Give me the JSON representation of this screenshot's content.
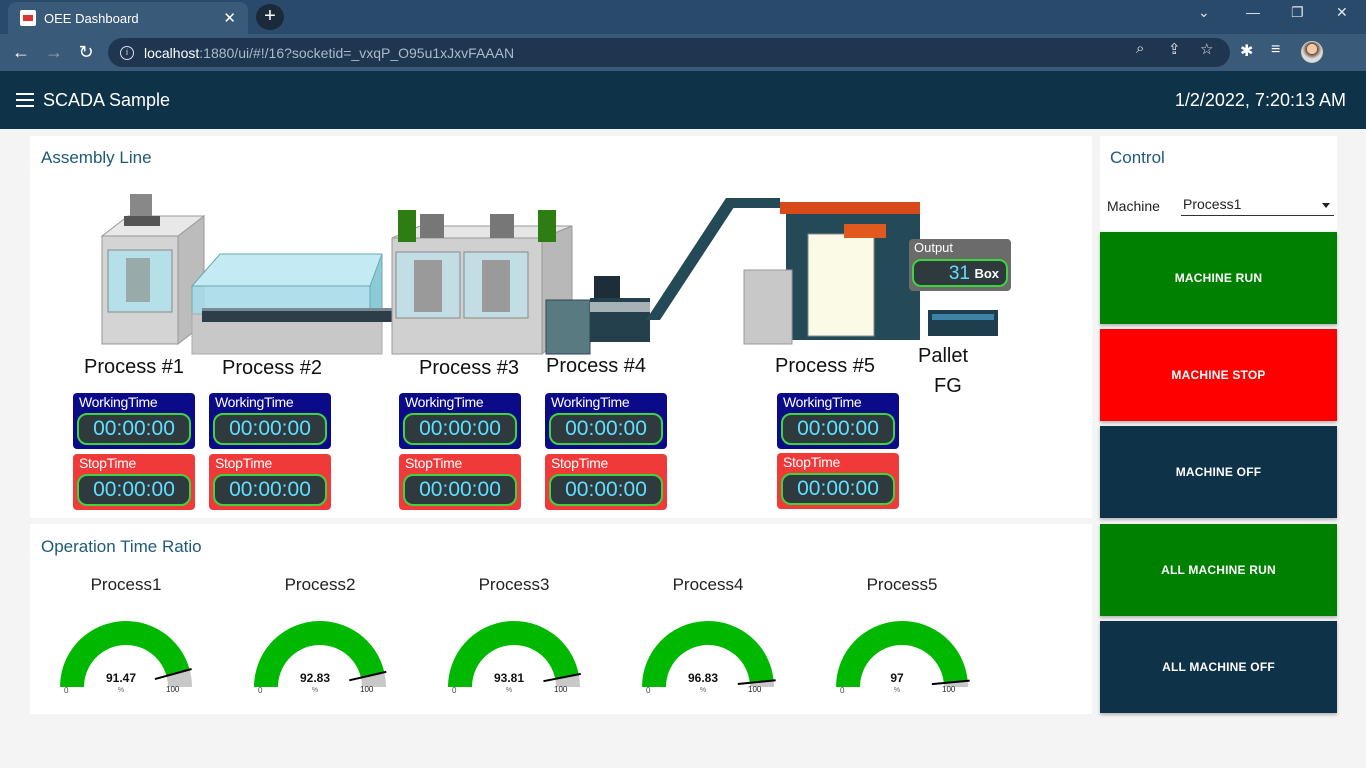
{
  "browser": {
    "tab_title": "OEE Dashboard",
    "url_host": "localhost",
    "url_path": ":1880/ui/#!/16?socketid=_vxqP_O95u1xJxvFAAAN"
  },
  "header": {
    "title": "SCADA Sample",
    "clock": "1/2/2022, 7:20:13 AM"
  },
  "assembly": {
    "title": "Assembly Line",
    "labels": {
      "p1": "Process #1",
      "p2": "Process #2",
      "p3": "Process #3",
      "p4": "Process #4",
      "p5": "Process #5",
      "pallet_1": "Pallet",
      "pallet_2": "FG"
    },
    "timer_labels": {
      "working": "WorkingTime",
      "stop": "StopTime"
    },
    "timers": {
      "p1": {
        "working": "00:00:00",
        "stop": "00:00:00"
      },
      "p2": {
        "working": "00:00:00",
        "stop": "00:00:00"
      },
      "p3": {
        "working": "00:00:00",
        "stop": "00:00:00"
      },
      "p4": {
        "working": "00:00:00",
        "stop": "00:00:00"
      },
      "p5": {
        "working": "00:00:00",
        "stop": "00:00:00"
      }
    },
    "output": {
      "label": "Output",
      "value": "31",
      "unit": "Box"
    }
  },
  "ratio": {
    "title": "Operation Time Ratio",
    "min_label": "0",
    "max_label": "100",
    "unit": "%",
    "gauges": [
      {
        "name": "Process1",
        "value": 91.47,
        "display": "91.47"
      },
      {
        "name": "Process2",
        "value": 92.83,
        "display": "92.83"
      },
      {
        "name": "Process3",
        "value": 93.81,
        "display": "93.81"
      },
      {
        "name": "Process4",
        "value": 96.83,
        "display": "96.83"
      },
      {
        "name": "Process5",
        "value": 97,
        "display": "97"
      }
    ],
    "colors": {
      "fill": "#00b800",
      "rest": "#c8c8c8"
    }
  },
  "control": {
    "title": "Control",
    "machine_label": "Machine",
    "machine_selected": "Process1",
    "buttons": {
      "run": "MACHINE RUN",
      "stop": "MACHINE STOP",
      "off": "MACHINE OFF",
      "all_run": "ALL MACHINE RUN",
      "all_off": "ALL MACHINE OFF"
    },
    "colors": {
      "run": "#008000",
      "stop": "#ff0000",
      "off": "#0e3247"
    }
  }
}
